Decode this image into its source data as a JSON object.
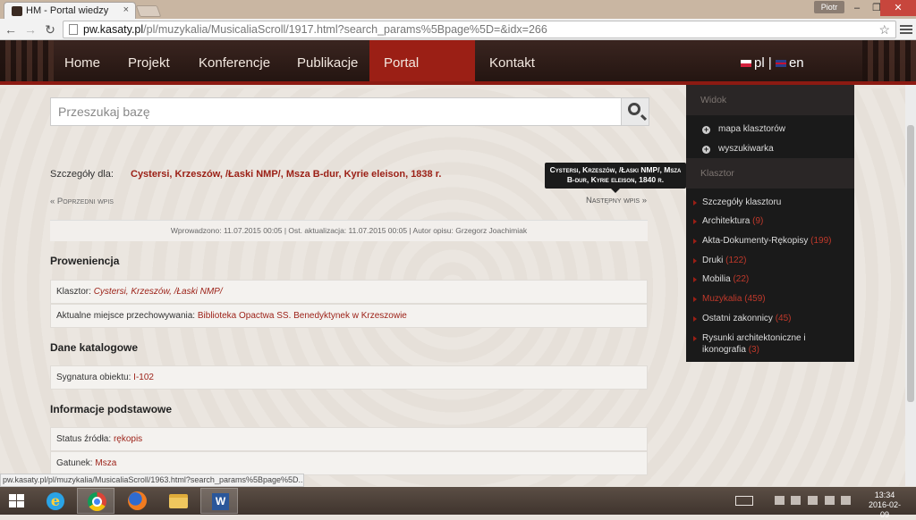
{
  "browser": {
    "tab_title": "HM - Portal wiedzy",
    "tab_close": "×",
    "user": "Piotr",
    "url_host": "pw.kasaty.pl",
    "url_path": "/pl/muzykalia/MusicaliaScroll/1917.html?search_params%5Bpage%5D=&idx=266",
    "status_url": "pw.kasaty.pl/pl/muzykalia/MusicaliaScroll/1963.html?search_params%5Bpage%5D...",
    "win_min": "–",
    "win_max": "❐",
    "win_close": "✕"
  },
  "nav": {
    "items": [
      "Home",
      "Projekt",
      "Konferencje",
      "Publikacje",
      "Portal wiedzy",
      "Kontakt"
    ],
    "active": "Portal wiedzy",
    "lang_pl": "pl",
    "lang_sep": "|",
    "lang_en": "en"
  },
  "search": {
    "placeholder": "Przeszukaj bazę"
  },
  "details": {
    "label": "Szczegóły dla:",
    "value": "Cystersi, Krzeszów, /Łaski NMP/, Msza B-dur, Kyrie eleison, 1838 r.",
    "tooltip": "Cystersi, Krzeszów, /Łaski NMP/, Msza B-dur, Kyrie eleison, 1840 r.",
    "prev": "« Poprzedni wpis",
    "next": "Następny wpis »",
    "meta": "Wprowadzono: 11.07.2015 00:05 | Ost. aktualizacja: 11.07.2015 00:05 | Autor opisu: Grzegorz Joachimiak"
  },
  "sections": {
    "proweniencja": {
      "title": "Proweniencja",
      "klasztor_label": "Klasztor:",
      "klasztor_value": "Cystersi, Krzeszów, /Łaski NMP/",
      "miejsce_label": "Aktualne miejsce przechowywania:",
      "miejsce_value": "Biblioteka Opactwa SS. Benedyktynek w Krzeszowie"
    },
    "katalogowe": {
      "title": "Dane katalogowe",
      "sygnatura_label": "Sygnatura obiektu:",
      "sygnatura_value": "I-102"
    },
    "podstawowe": {
      "title": "Informacje podstawowe",
      "status_label": "Status źródła:",
      "status_value": "rękopis",
      "gatunek_label": "Gatunek:",
      "gatunek_value": "Msza"
    }
  },
  "sidebar": {
    "widok_head": "Widok",
    "widok_items": [
      "mapa klasztorów",
      "wyszukiwarka"
    ],
    "klasztor_head": "Klasztor",
    "links": [
      {
        "label": "Szczegóły klasztoru",
        "count": ""
      },
      {
        "label": "Architektura",
        "count": "(9)"
      },
      {
        "label": "Akta-Dokumenty-Rękopisy",
        "count": "(199)"
      },
      {
        "label": "Druki",
        "count": "(122)"
      },
      {
        "label": "Mobilia",
        "count": "(22)"
      },
      {
        "label": "Muzykalia",
        "count": "(459)"
      },
      {
        "label": "Ostatni zakonnicy",
        "count": "(45)"
      },
      {
        "label": "Rysunki architektoniczne i ikonografia",
        "count": "(3)"
      }
    ]
  },
  "taskbar": {
    "time": "13:34",
    "date": "2016-02-09"
  }
}
